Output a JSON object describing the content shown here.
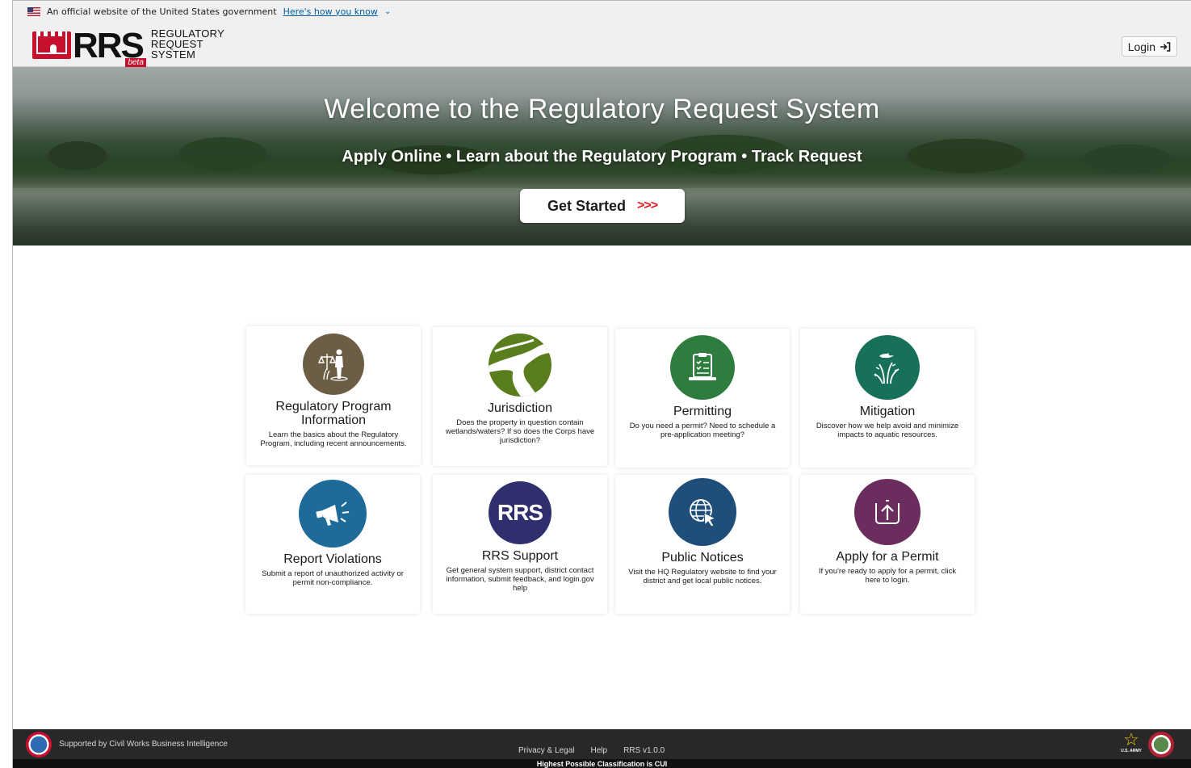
{
  "gov_banner": {
    "text": "An official website of the United States government",
    "link": "Here's how you know"
  },
  "header": {
    "logo_mark": "RRS",
    "logo_beta": "beta",
    "logo_line1": "REGULATORY",
    "logo_line2": "REQUEST",
    "logo_line3": "SYSTEM",
    "login_label": "Login"
  },
  "hero": {
    "title": "Welcome to the Regulatory Request System",
    "subtitle": "Apply Online • Learn about the Regulatory Program • Track Request",
    "cta_label": "Get Started",
    "cta_arrows": ">>>"
  },
  "cards": [
    {
      "title": "Regulatory Program Information",
      "desc": "Learn the basics about the Regulatory Program, including recent announcements.",
      "color": "#6b5e45",
      "icon": "scales-person-icon"
    },
    {
      "title": "Jurisdiction",
      "desc": "Does the property in question contain wetlands/waters? If so does the Corps have jurisdiction?",
      "color": "#5a7d1e",
      "icon": "river-icon"
    },
    {
      "title": "Permitting",
      "desc": "Do you need a permit? Need to schedule a pre-application meeting?",
      "color": "#2e7d3e",
      "icon": "clipboard-checklist-icon"
    },
    {
      "title": "Mitigation",
      "desc": "Discover how we help avoid and minimize impacts to aquatic resources.",
      "color": "#16705a",
      "icon": "bird-reeds-icon"
    },
    {
      "title": "Report Violations",
      "desc": "Submit a report of unauthorized activity or permit non-compliance.",
      "color": "#1e6b9a",
      "icon": "megaphone-icon"
    },
    {
      "title": "RRS Support",
      "desc": "Get general system support, district contact information, submit feedback, and login.gov help",
      "color": "#2f2f6e",
      "icon": "rrs-text-icon",
      "icon_text": "RRS"
    },
    {
      "title": "Public Notices",
      "desc": "Visit the HQ Regulatory website to find your district and get local public notices.",
      "color": "#1f4e78",
      "icon": "globe-cursor-icon"
    },
    {
      "title": "Apply for a Permit",
      "desc": "If you're ready to apply for a permit, click here to login.",
      "color": "#6b2d5e",
      "icon": "upload-arrow-icon"
    }
  ],
  "footer": {
    "support_text": "Supported by Civil Works Business Intelligence",
    "privacy": "Privacy & Legal",
    "help": "Help",
    "version": "RRS v1.0.0",
    "classification": "Highest Possible Classification is CUI",
    "army_label": "U.S. ARMY"
  }
}
